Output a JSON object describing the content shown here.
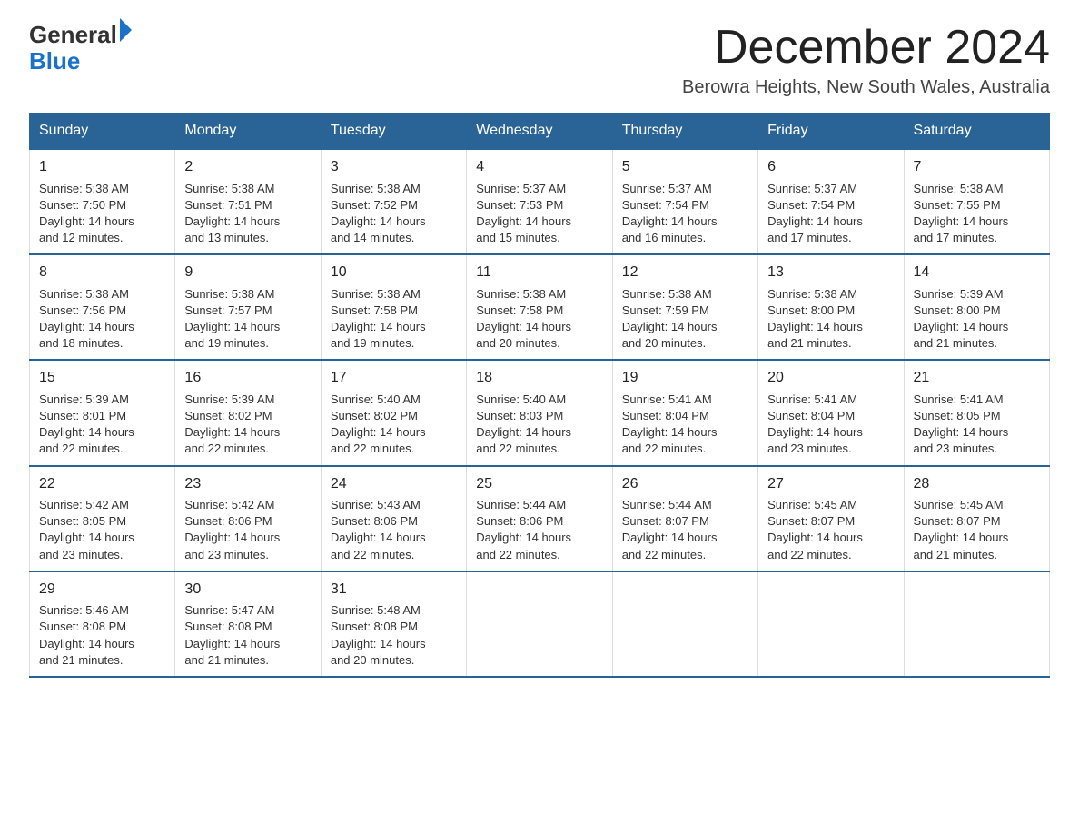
{
  "logo": {
    "text_general": "General",
    "text_blue": "Blue",
    "triangle": "▶"
  },
  "title": "December 2024",
  "subtitle": "Berowra Heights, New South Wales, Australia",
  "weekdays": [
    "Sunday",
    "Monday",
    "Tuesday",
    "Wednesday",
    "Thursday",
    "Friday",
    "Saturday"
  ],
  "weeks": [
    [
      {
        "day": "1",
        "sunrise": "5:38 AM",
        "sunset": "7:50 PM",
        "daylight": "14 hours and 12 minutes."
      },
      {
        "day": "2",
        "sunrise": "5:38 AM",
        "sunset": "7:51 PM",
        "daylight": "14 hours and 13 minutes."
      },
      {
        "day": "3",
        "sunrise": "5:38 AM",
        "sunset": "7:52 PM",
        "daylight": "14 hours and 14 minutes."
      },
      {
        "day": "4",
        "sunrise": "5:37 AM",
        "sunset": "7:53 PM",
        "daylight": "14 hours and 15 minutes."
      },
      {
        "day": "5",
        "sunrise": "5:37 AM",
        "sunset": "7:54 PM",
        "daylight": "14 hours and 16 minutes."
      },
      {
        "day": "6",
        "sunrise": "5:37 AM",
        "sunset": "7:54 PM",
        "daylight": "14 hours and 17 minutes."
      },
      {
        "day": "7",
        "sunrise": "5:38 AM",
        "sunset": "7:55 PM",
        "daylight": "14 hours and 17 minutes."
      }
    ],
    [
      {
        "day": "8",
        "sunrise": "5:38 AM",
        "sunset": "7:56 PM",
        "daylight": "14 hours and 18 minutes."
      },
      {
        "day": "9",
        "sunrise": "5:38 AM",
        "sunset": "7:57 PM",
        "daylight": "14 hours and 19 minutes."
      },
      {
        "day": "10",
        "sunrise": "5:38 AM",
        "sunset": "7:58 PM",
        "daylight": "14 hours and 19 minutes."
      },
      {
        "day": "11",
        "sunrise": "5:38 AM",
        "sunset": "7:58 PM",
        "daylight": "14 hours and 20 minutes."
      },
      {
        "day": "12",
        "sunrise": "5:38 AM",
        "sunset": "7:59 PM",
        "daylight": "14 hours and 20 minutes."
      },
      {
        "day": "13",
        "sunrise": "5:38 AM",
        "sunset": "8:00 PM",
        "daylight": "14 hours and 21 minutes."
      },
      {
        "day": "14",
        "sunrise": "5:39 AM",
        "sunset": "8:00 PM",
        "daylight": "14 hours and 21 minutes."
      }
    ],
    [
      {
        "day": "15",
        "sunrise": "5:39 AM",
        "sunset": "8:01 PM",
        "daylight": "14 hours and 22 minutes."
      },
      {
        "day": "16",
        "sunrise": "5:39 AM",
        "sunset": "8:02 PM",
        "daylight": "14 hours and 22 minutes."
      },
      {
        "day": "17",
        "sunrise": "5:40 AM",
        "sunset": "8:02 PM",
        "daylight": "14 hours and 22 minutes."
      },
      {
        "day": "18",
        "sunrise": "5:40 AM",
        "sunset": "8:03 PM",
        "daylight": "14 hours and 22 minutes."
      },
      {
        "day": "19",
        "sunrise": "5:41 AM",
        "sunset": "8:04 PM",
        "daylight": "14 hours and 22 minutes."
      },
      {
        "day": "20",
        "sunrise": "5:41 AM",
        "sunset": "8:04 PM",
        "daylight": "14 hours and 23 minutes."
      },
      {
        "day": "21",
        "sunrise": "5:41 AM",
        "sunset": "8:05 PM",
        "daylight": "14 hours and 23 minutes."
      }
    ],
    [
      {
        "day": "22",
        "sunrise": "5:42 AM",
        "sunset": "8:05 PM",
        "daylight": "14 hours and 23 minutes."
      },
      {
        "day": "23",
        "sunrise": "5:42 AM",
        "sunset": "8:06 PM",
        "daylight": "14 hours and 23 minutes."
      },
      {
        "day": "24",
        "sunrise": "5:43 AM",
        "sunset": "8:06 PM",
        "daylight": "14 hours and 22 minutes."
      },
      {
        "day": "25",
        "sunrise": "5:44 AM",
        "sunset": "8:06 PM",
        "daylight": "14 hours and 22 minutes."
      },
      {
        "day": "26",
        "sunrise": "5:44 AM",
        "sunset": "8:07 PM",
        "daylight": "14 hours and 22 minutes."
      },
      {
        "day": "27",
        "sunrise": "5:45 AM",
        "sunset": "8:07 PM",
        "daylight": "14 hours and 22 minutes."
      },
      {
        "day": "28",
        "sunrise": "5:45 AM",
        "sunset": "8:07 PM",
        "daylight": "14 hours and 21 minutes."
      }
    ],
    [
      {
        "day": "29",
        "sunrise": "5:46 AM",
        "sunset": "8:08 PM",
        "daylight": "14 hours and 21 minutes."
      },
      {
        "day": "30",
        "sunrise": "5:47 AM",
        "sunset": "8:08 PM",
        "daylight": "14 hours and 21 minutes."
      },
      {
        "day": "31",
        "sunrise": "5:48 AM",
        "sunset": "8:08 PM",
        "daylight": "14 hours and 20 minutes."
      },
      null,
      null,
      null,
      null
    ]
  ],
  "labels": {
    "sunrise": "Sunrise:",
    "sunset": "Sunset:",
    "daylight": "Daylight:"
  }
}
